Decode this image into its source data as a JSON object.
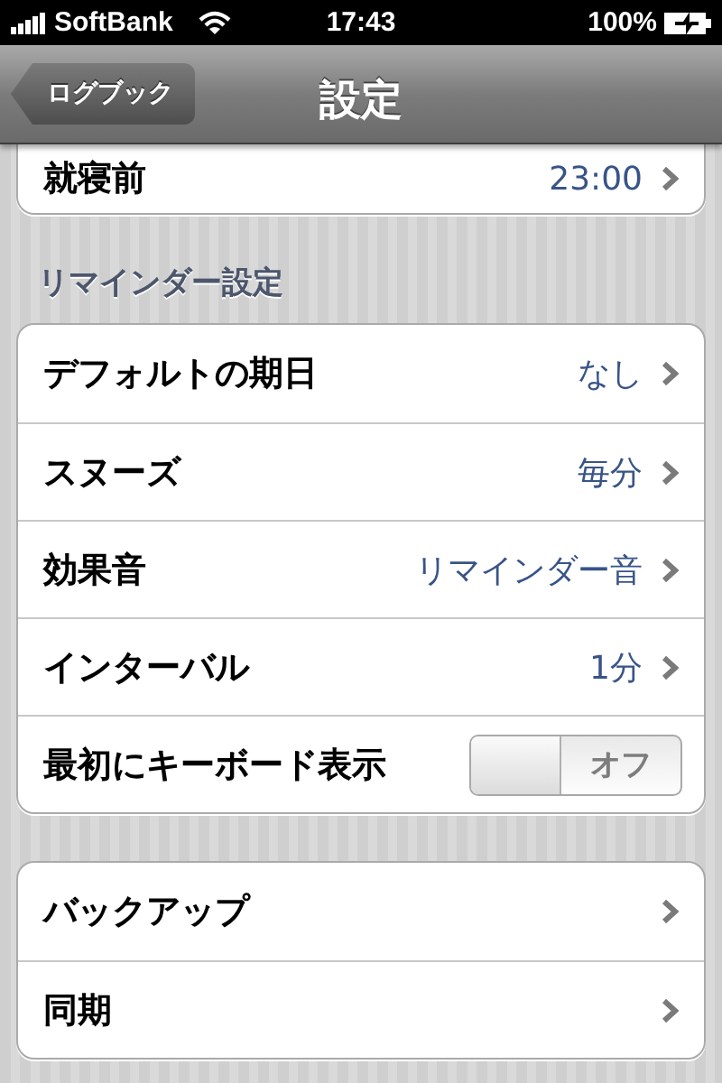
{
  "status_bar": {
    "carrier": "SoftBank",
    "time": "17:43",
    "battery": "100%"
  },
  "nav_bar": {
    "back_button": "ログブック",
    "title": "設定"
  },
  "sections": [
    {
      "cut_top": true,
      "rows": [
        {
          "kind": "disclosure",
          "label": "就寝前",
          "value": "23:00"
        }
      ]
    },
    {
      "header": "リマインダー設定",
      "rows": [
        {
          "kind": "disclosure",
          "label": "デフォルトの期日",
          "value": "なし"
        },
        {
          "kind": "disclosure",
          "label": "スヌーズ",
          "value": "毎分"
        },
        {
          "kind": "disclosure",
          "label": "効果音",
          "value": "リマインダー音"
        },
        {
          "kind": "disclosure",
          "label": "インターバル",
          "value": "1分"
        },
        {
          "kind": "toggle",
          "label": "最初にキーボード表示",
          "on": false,
          "state_label": "オフ"
        }
      ]
    },
    {
      "rows": [
        {
          "kind": "disclosure",
          "label": "バックアップ"
        },
        {
          "kind": "disclosure",
          "label": "同期"
        }
      ]
    }
  ]
}
